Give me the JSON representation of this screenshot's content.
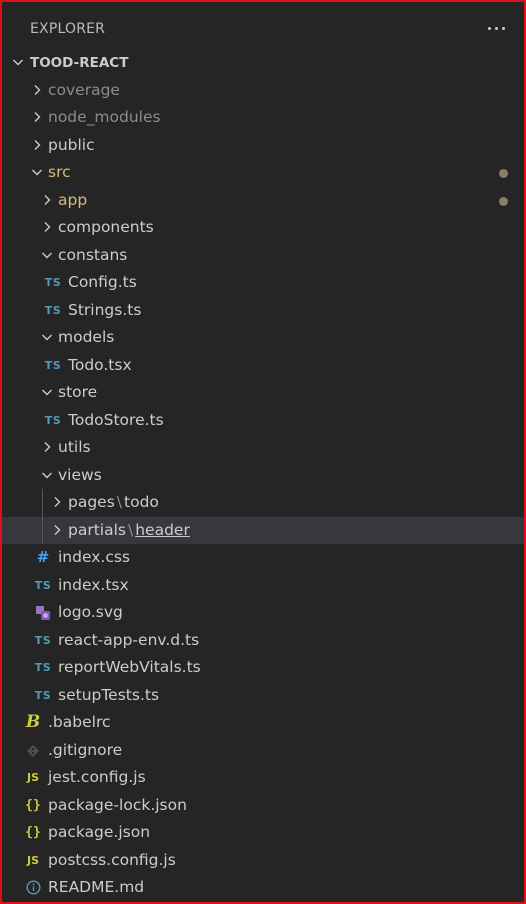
{
  "explorer": {
    "title": "EXPLORER",
    "root_label": "TOOD-REACT"
  },
  "tree": {
    "coverage": "coverage",
    "node_modules": "node_modules",
    "public": "public",
    "src": "src",
    "app": "app",
    "components": "components",
    "constans": "constans",
    "config_ts": "Config.ts",
    "strings_ts": "Strings.ts",
    "models": "models",
    "todo_tsx": "Todo.tsx",
    "store": "store",
    "todostore_ts": "TodoStore.ts",
    "utils": "utils",
    "views": "views",
    "pages": "pages",
    "todo": "todo",
    "partials": "partials",
    "header": "header",
    "index_css": "index.css",
    "index_tsx": "index.tsx",
    "logo_svg": "logo.svg",
    "react_app_env": "react-app-env.d.ts",
    "report_web_vitals": "reportWebVitals.ts",
    "setup_tests": "setupTests.ts",
    "babelrc": ".babelrc",
    "gitignore": ".gitignore",
    "jest_config": "jest.config.js",
    "package_lock": "package-lock.json",
    "package_json": "package.json",
    "postcss_config": "postcss.config.js",
    "readme": "README.md"
  },
  "icons": {
    "ts": "TS",
    "js": "JS",
    "json": "{}",
    "css": "#",
    "babel": "B"
  },
  "colors": {
    "background": "#252526",
    "selected_row": "#37373d",
    "ts_icon": "#519aba",
    "js_icon": "#cbcb41",
    "modified_folder": "#d7ba7d",
    "ignored_text": "#8c8c8c",
    "frame_border": "#e0101a"
  }
}
